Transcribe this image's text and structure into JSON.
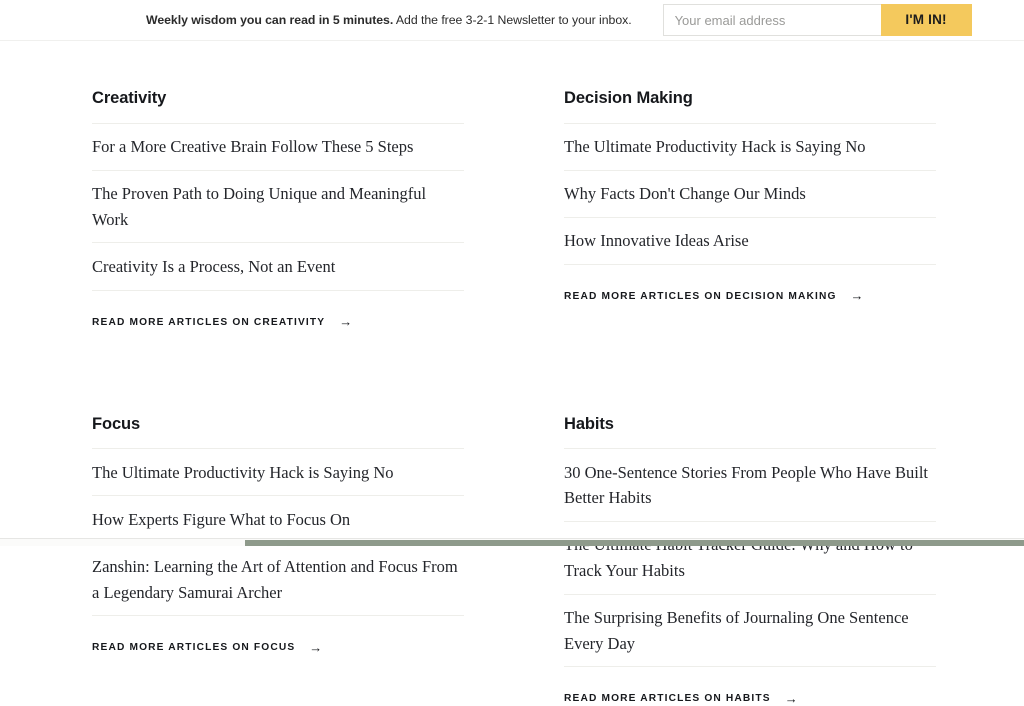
{
  "newsletter": {
    "headline_bold": "Weekly wisdom you can read in 5 minutes.",
    "headline_rest": " Add the free 3-2-1 Newsletter to your inbox.",
    "email_placeholder": "Your email address",
    "email_value": "",
    "submit_label": "I'M IN!",
    "accent_color": "#f4c95d"
  },
  "categories": [
    {
      "title": "Creativity",
      "articles": [
        "For a More Creative Brain Follow These 5 Steps",
        "The Proven Path to Doing Unique and Meaningful Work",
        "Creativity Is a Process, Not an Event"
      ],
      "read_more_label": "READ MORE ARTICLES ON CREATIVITY",
      "arrow": "→"
    },
    {
      "title": "Decision Making",
      "articles": [
        "The Ultimate Productivity Hack is Saying No",
        "Why Facts Don't Change Our Minds",
        "How Innovative Ideas Arise"
      ],
      "read_more_label": "READ MORE ARTICLES ON DECISION MAKING",
      "arrow": "→"
    },
    {
      "title": "Focus",
      "articles": [
        "The Ultimate Productivity Hack is Saying No",
        "How Experts Figure What to Focus On",
        "Zanshin: Learning the Art of Attention and Focus From a Legendary Samurai Archer"
      ],
      "read_more_label": "READ MORE ARTICLES ON FOCUS",
      "arrow": "→"
    },
    {
      "title": "Habits",
      "articles": [
        "30 One-Sentence Stories From People Who Have Built Better Habits",
        "The Ultimate Habit Tracker Guide: Why and How to Track Your Habits",
        "The Surprising Benefits of Journaling One Sentence Every Day"
      ],
      "read_more_label": "READ MORE ARTICLES ON HABITS",
      "arrow": "→"
    }
  ]
}
